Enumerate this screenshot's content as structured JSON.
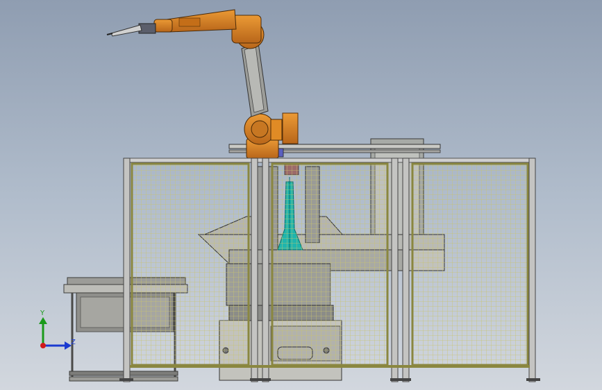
{
  "viewport": {
    "background_top": "#8f9db1",
    "background_bottom": "#d2d7de"
  },
  "colors": {
    "robot_orange": "#d9811e",
    "robot_dark": "#a85a10",
    "fence_mesh": "#c8c26a",
    "fence_frame": "#8a8740",
    "post": "#b7b7b7",
    "machine_gray": "#b5b5b0",
    "machine_dark": "#6e6e6a",
    "nozzle_cyan": "#1aa5a0"
  },
  "triad": {
    "y_label": "Y",
    "z_label": "Z",
    "y_color": "#1a9a1a",
    "z_color": "#1a3ad0",
    "origin_color": "#d01a1a"
  }
}
